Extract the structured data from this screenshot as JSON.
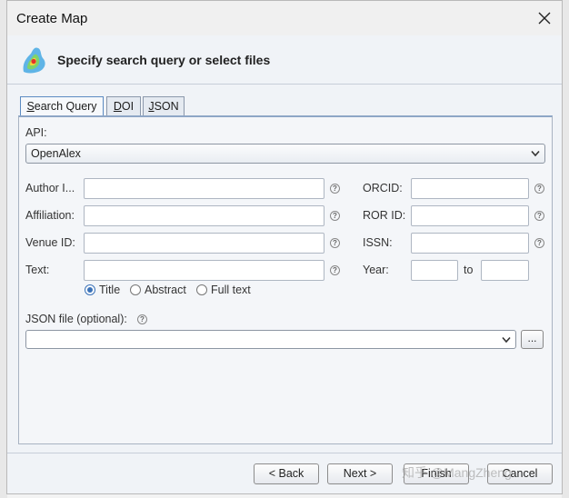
{
  "window": {
    "title": "Create Map"
  },
  "header": {
    "text": "Specify search query or select files"
  },
  "tabs": [
    {
      "label": "Search Query",
      "mnemonic": "S",
      "rest": "earch Query"
    },
    {
      "label": "DOI",
      "mnemonic": "D",
      "rest": "OI"
    },
    {
      "label": "JSON",
      "mnemonic": "J",
      "rest": "SON"
    }
  ],
  "form": {
    "api_label": "API:",
    "api_value": "OpenAlex",
    "author_label": "Author I...",
    "affiliation_label": "Affiliation:",
    "venue_label": "Venue ID:",
    "text_label": "Text:",
    "orcid_label": "ORCID:",
    "ror_label": "ROR ID:",
    "issn_label": "ISSN:",
    "year_label": "Year:",
    "year_to_label": "to",
    "radio": {
      "title": "Title",
      "abstract": "Abstract",
      "fulltext": "Full text",
      "selected": "Title"
    },
    "json_file_label": "JSON file (optional):",
    "browse_label": "...",
    "help_glyph": "?"
  },
  "buttons": {
    "back": "< Back",
    "next": "Next >",
    "finish": "Finish",
    "cancel": "Cancel"
  },
  "watermark": "知乎 @MangZheng"
}
